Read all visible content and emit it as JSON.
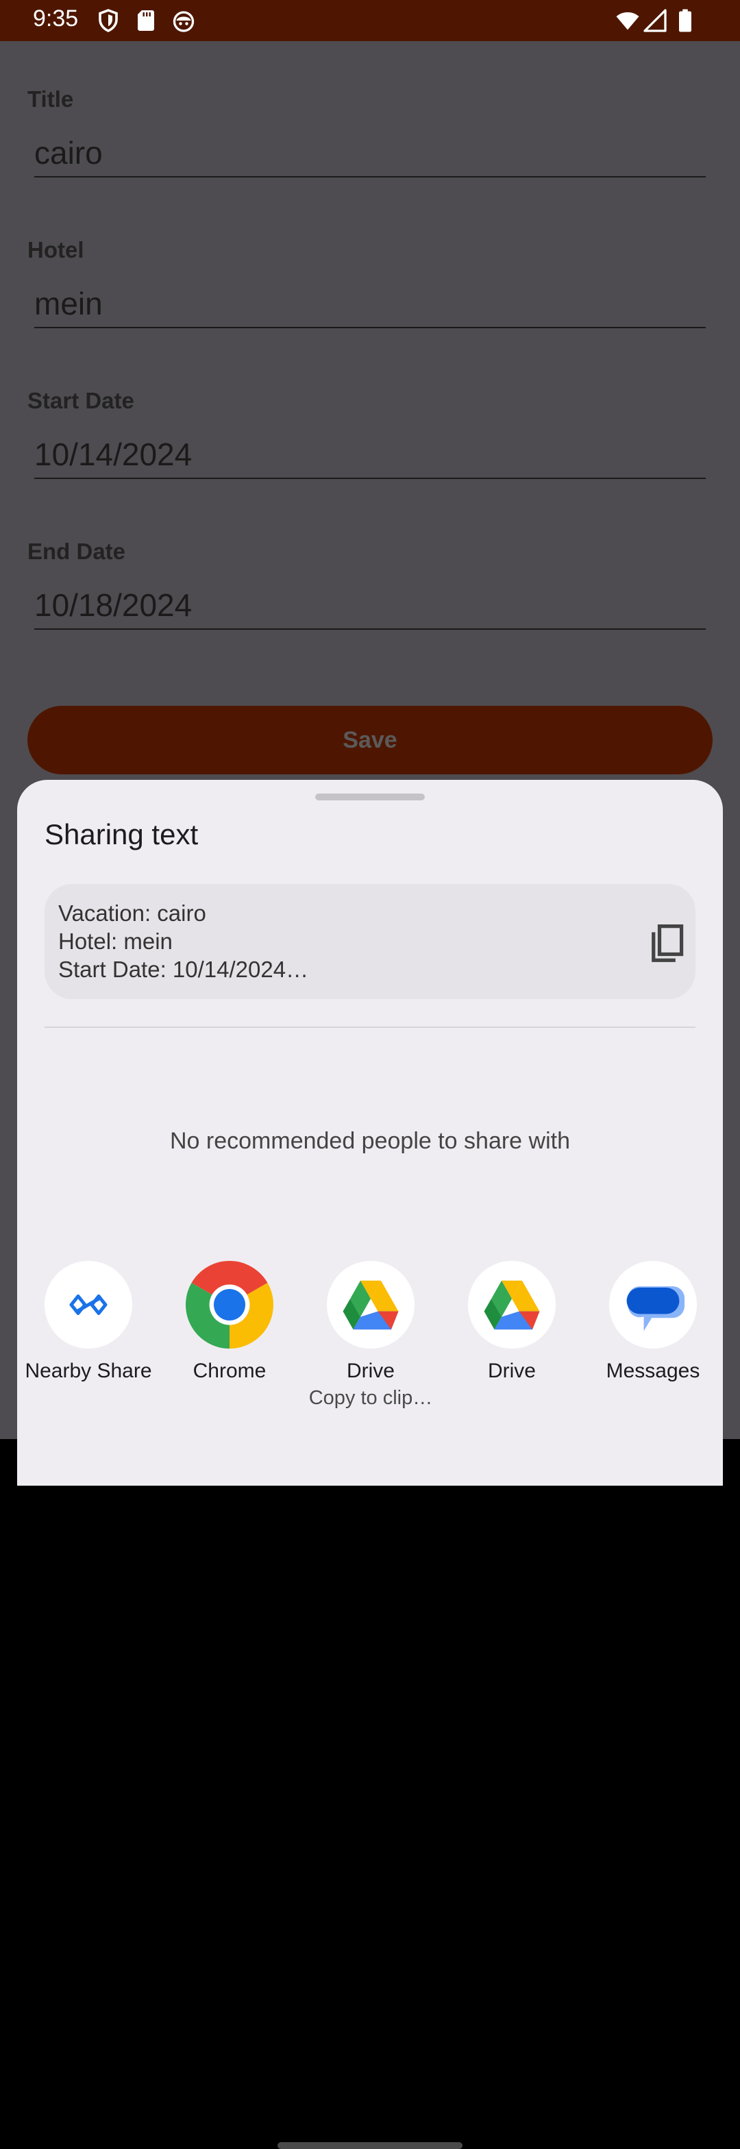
{
  "status_bar": {
    "time": "9:35",
    "left_icons": [
      "shield-icon",
      "sd-card-icon",
      "android-robot-icon"
    ],
    "right_icons": [
      "wifi-icon",
      "signal-icon",
      "battery-icon"
    ]
  },
  "form": {
    "fields": [
      {
        "label": "Title",
        "value": "cairo"
      },
      {
        "label": "Hotel",
        "value": "mein"
      },
      {
        "label": "Start Date",
        "value": "10/14/2024"
      },
      {
        "label": "End Date",
        "value": "10/18/2024"
      }
    ],
    "save_label": "Save"
  },
  "share_sheet": {
    "title": "Sharing text",
    "preview_lines": [
      "Vacation: cairo",
      "Hotel: mein",
      "Start Date: 10/14/2024…"
    ],
    "copy_icon": "copy-icon",
    "no_people_text": "No recommended people to share with",
    "targets": [
      {
        "label": "Nearby Share",
        "icon": "nearby-share-icon"
      },
      {
        "label": "Chrome",
        "icon": "chrome-icon"
      },
      {
        "label": "Drive",
        "sublabel": "Copy to clip…",
        "icon": "drive-icon"
      },
      {
        "label": "Drive",
        "icon": "drive-icon"
      },
      {
        "label": "Messages",
        "icon": "messages-icon"
      }
    ]
  },
  "colors": {
    "status_bar": "#4e1600",
    "scrim_background": "#4e4c50",
    "save_button": "#4e1600",
    "sheet_background": "#efedf2",
    "preview_background": "#e5e3e8"
  }
}
